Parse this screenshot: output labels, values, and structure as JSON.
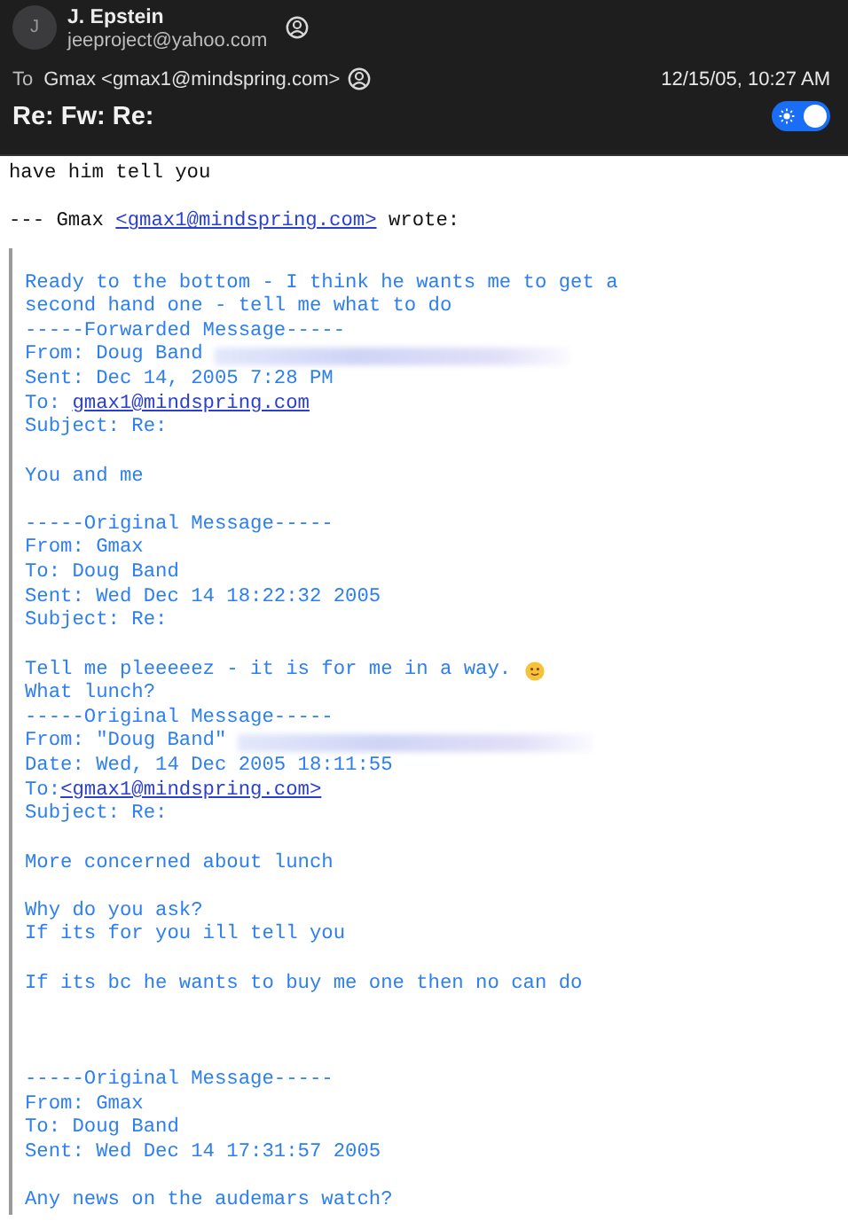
{
  "header": {
    "avatar_initial": "J",
    "sender_name": "J. Epstein",
    "sender_email": "jeeproject@yahoo.com",
    "to_label": "To",
    "recipient": "Gmax <gmax1@mindspring.com>",
    "date": "12/15/05, 10:27 AM",
    "subject": "Re: Fw: Re:",
    "toggle": {
      "on": true
    }
  },
  "reply_lines": [
    {
      "kind": "text",
      "text": "have him tell you"
    },
    {
      "kind": "blank"
    },
    {
      "kind": "link",
      "prefix": "--- Gmax ",
      "link": "<gmax1@mindspring.com>",
      "suffix": " wrote:"
    }
  ],
  "quoted_lines": [
    {
      "kind": "blank"
    },
    {
      "kind": "text",
      "text": "Ready to the bottom - I think he wants me to get a"
    },
    {
      "kind": "text",
      "text": "second hand one - tell me what to do"
    },
    {
      "kind": "text",
      "text": "-----Forwarded Message-----"
    },
    {
      "kind": "redacted",
      "text": "From: Doug Band "
    },
    {
      "kind": "text",
      "text": "Sent: Dec 14, 2005 7:28 PM"
    },
    {
      "kind": "link",
      "prefix": "To: ",
      "link": "gmax1@mindspring.com"
    },
    {
      "kind": "text",
      "text": "Subject: Re:"
    },
    {
      "kind": "blank"
    },
    {
      "kind": "text",
      "text": "You and me"
    },
    {
      "kind": "blank"
    },
    {
      "kind": "text",
      "text": "-----Original Message-----"
    },
    {
      "kind": "text",
      "text": "From: Gmax"
    },
    {
      "kind": "text",
      "text": "To: Doug Band"
    },
    {
      "kind": "text",
      "text": "Sent: Wed Dec 14 18:22:32 2005"
    },
    {
      "kind": "text",
      "text": "Subject: Re:"
    },
    {
      "kind": "blank"
    },
    {
      "kind": "emoji",
      "text": "Tell me pleeeeez - it is for me in a way. "
    },
    {
      "kind": "text",
      "text": "What lunch?"
    },
    {
      "kind": "text",
      "text": "-----Original Message-----"
    },
    {
      "kind": "redacted",
      "text": "From: \"Doug Band\" "
    },
    {
      "kind": "text",
      "text": "Date: Wed, 14 Dec 2005 18:11:55"
    },
    {
      "kind": "link",
      "prefix": "To:",
      "link": "<gmax1@mindspring.com>"
    },
    {
      "kind": "text",
      "text": "Subject: Re:"
    },
    {
      "kind": "blank"
    },
    {
      "kind": "text",
      "text": "More concerned about lunch"
    },
    {
      "kind": "blank"
    },
    {
      "kind": "text",
      "text": "Why do you ask?"
    },
    {
      "kind": "text",
      "text": "If its for you ill tell you"
    },
    {
      "kind": "blank"
    },
    {
      "kind": "text",
      "text": "If its bc he wants to buy me one then no can do"
    },
    {
      "kind": "blank"
    },
    {
      "kind": "blank"
    },
    {
      "kind": "blank"
    },
    {
      "kind": "text",
      "text": "-----Original Message-----"
    },
    {
      "kind": "text",
      "text": "From: Gmax"
    },
    {
      "kind": "text",
      "text": "To: Doug Band"
    },
    {
      "kind": "text",
      "text": "Sent: Wed Dec 14 17:31:57 2005"
    },
    {
      "kind": "blank"
    },
    {
      "kind": "text",
      "text": "Any news on the audemars watch?"
    }
  ]
}
